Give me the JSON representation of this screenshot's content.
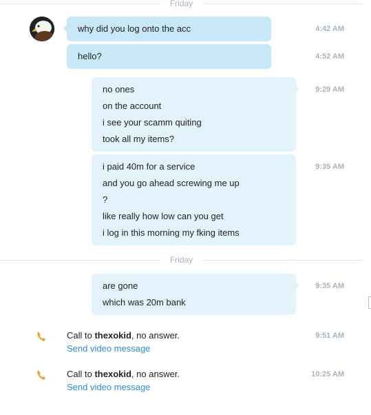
{
  "dividers": [
    "Friday",
    "Friday"
  ],
  "contact": {
    "avatar_icon": "eagle-avatar"
  },
  "messages": [
    {
      "lines": [
        "why did you log onto the acc"
      ],
      "time": "4:42 AM"
    },
    {
      "lines": [
        "hello?"
      ],
      "time": "4:52 AM"
    },
    {
      "lines": [
        "no ones",
        "on the account",
        "i see your scamm quiting",
        "took all my items?"
      ],
      "time": "9:29 AM"
    },
    {
      "lines": [
        "i paid 40m for  a service",
        "and you go ahead screwing me up",
        "?",
        "like really how low can you get",
        "i log in this morning my fking items"
      ],
      "time": "9:35 AM"
    },
    {
      "lines": [
        "are gone",
        "which was 20m bank"
      ],
      "time": "9:35 AM"
    }
  ],
  "calls": [
    {
      "prefix": "Call to ",
      "name": "thexokid",
      "suffix": ", no answer.",
      "link": "Send video message",
      "time": "9:51 AM",
      "icon": "phone-icon"
    },
    {
      "prefix": "Call to ",
      "name": "thexokid",
      "suffix": ", no answer.",
      "link": "Send video message",
      "time": "10:25 AM",
      "icon": "phone-icon"
    }
  ],
  "colors": {
    "incoming_bubble": "#c8e7f7",
    "outgoing_bubble": "#e3f3fb",
    "timestamp": "#a5b3c0",
    "link": "#2d8ad8",
    "phone_icon": "#f0a02c"
  }
}
